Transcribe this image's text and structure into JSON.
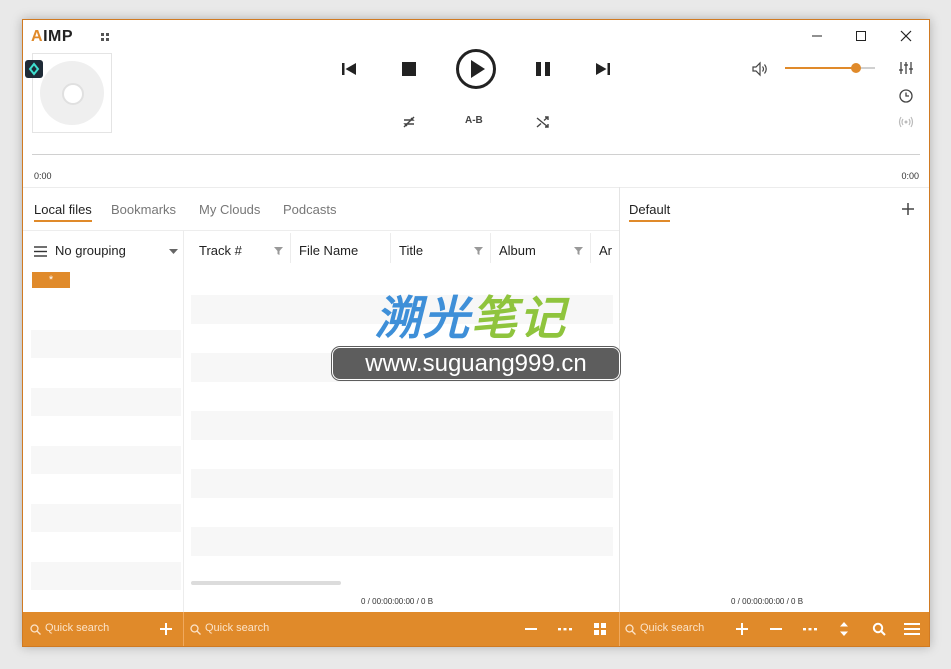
{
  "app": {
    "logo_text": "AIMP",
    "logo_accent": "A",
    "accent_color": "#e08a2a"
  },
  "window_controls": {
    "minimize": "minimize-icon",
    "maximize": "maximize-icon",
    "close": "close-icon"
  },
  "player": {
    "time_elapsed": "0:00",
    "time_total": "0:00",
    "ab_label": "A-B",
    "volume_level": 0.8
  },
  "source_tabs": [
    {
      "label": "Local files",
      "active": true
    },
    {
      "label": "Bookmarks",
      "active": false
    },
    {
      "label": "My Clouds",
      "active": false
    },
    {
      "label": "Podcasts",
      "active": false
    }
  ],
  "grouping": {
    "label": "No grouping",
    "star": "*"
  },
  "columns": [
    "Track #",
    "File Name",
    "Title",
    "Album",
    "Ar"
  ],
  "library_status": "0 / 00:00:00:00 / 0 B",
  "playlist": {
    "tab": "Default",
    "status": "0 / 00:00:00:00 / 0 B"
  },
  "search": {
    "groups_placeholder": "Quick search",
    "library_placeholder": "Quick search",
    "playlist_placeholder": "Quick search"
  },
  "watermark": {
    "cn_part1": "溯光",
    "cn_part2": "笔记",
    "url": "www.suguang999.cn"
  }
}
